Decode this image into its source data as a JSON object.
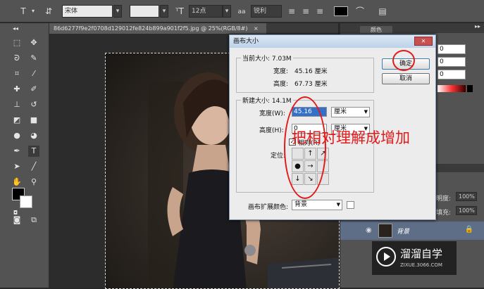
{
  "options_bar": {
    "font_family": "宋体",
    "font_size": "12点",
    "aa_label": "a",
    "aa_mode": "锐利"
  },
  "document_tab": {
    "title": "86d6277f9e2f0708d129012fe824b899a901f2f5.jpg @ 25%(RGB/8#)",
    "close": "×"
  },
  "dialog": {
    "title": "画布大小",
    "close": "✕",
    "current_size_label": "当前大小: 7.03M",
    "current_width_label": "宽度:",
    "current_width_value": "45.16 厘米",
    "current_height_label": "高度:",
    "current_height_value": "67.73 厘米",
    "new_size_label": "新建大小: 14.1M",
    "width_label": "宽度(W):",
    "width_value": "45.16",
    "width_unit": "厘米",
    "height_label": "高度(H):",
    "height_value": "0",
    "height_unit": "厘米",
    "relative_label": "相对(R)",
    "anchor_label": "定位:",
    "extension_color_label": "画布扩展颜色:",
    "extension_color_value": "背景",
    "ok_button": "确定",
    "cancel_button": "取消"
  },
  "annotation": "把相对理解成增加",
  "right_panel": {
    "panel_tab": "颜色",
    "color_values": [
      "0",
      "0",
      "0"
    ],
    "opacity_label": "明度:",
    "opacity_value": "100%",
    "fill_label": "填充:",
    "fill_value": "100%",
    "layer_name": "背景"
  },
  "watermark": {
    "brand": "溜溜自学",
    "url": "ZIXUE.3066.COM"
  },
  "colors": {
    "annotation_red": "#e31a1a",
    "ps_panel": "#535353",
    "dialog_bg": "#ececec"
  }
}
